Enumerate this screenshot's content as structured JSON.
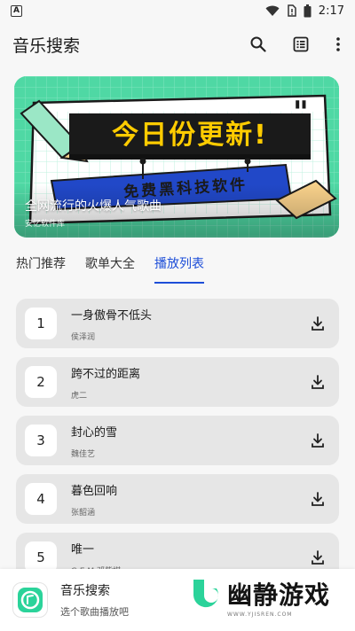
{
  "status_bar": {
    "time": "2:17",
    "notif_badge": "A"
  },
  "app_bar": {
    "title": "音乐搜索"
  },
  "banner": {
    "headline": "今日份更新!",
    "ribbon": "免费黑科技软件",
    "title": "全网流行的火爆人气歌曲",
    "subtitle": "安忆软件库"
  },
  "tabs": [
    {
      "label": "热门推荐"
    },
    {
      "label": "歌单大全"
    },
    {
      "label": "播放列表"
    }
  ],
  "songs": [
    {
      "index": "1",
      "title": "一身傲骨不低头",
      "artist": "侯泽润"
    },
    {
      "index": "2",
      "title": "跨不过的距离",
      "artist": "虎二"
    },
    {
      "index": "3",
      "title": "封心的雪",
      "artist": "魏佳艺"
    },
    {
      "index": "4",
      "title": "暮色回响",
      "artist": "张韶涵"
    },
    {
      "index": "5",
      "title": "唯一",
      "artist": "G.E.M.邓紫棋"
    }
  ],
  "bottom_bar": {
    "title": "音乐搜索",
    "subtitle": "选个歌曲播放吧"
  },
  "watermark": {
    "text": "幽静游戏",
    "url": "WWW.YJISREN.COM"
  },
  "colors": {
    "accent": "#1d4ed8",
    "banner_bg": "#4fd8a4",
    "headline": "#ffcc00",
    "ribbon": "#2148c8"
  }
}
